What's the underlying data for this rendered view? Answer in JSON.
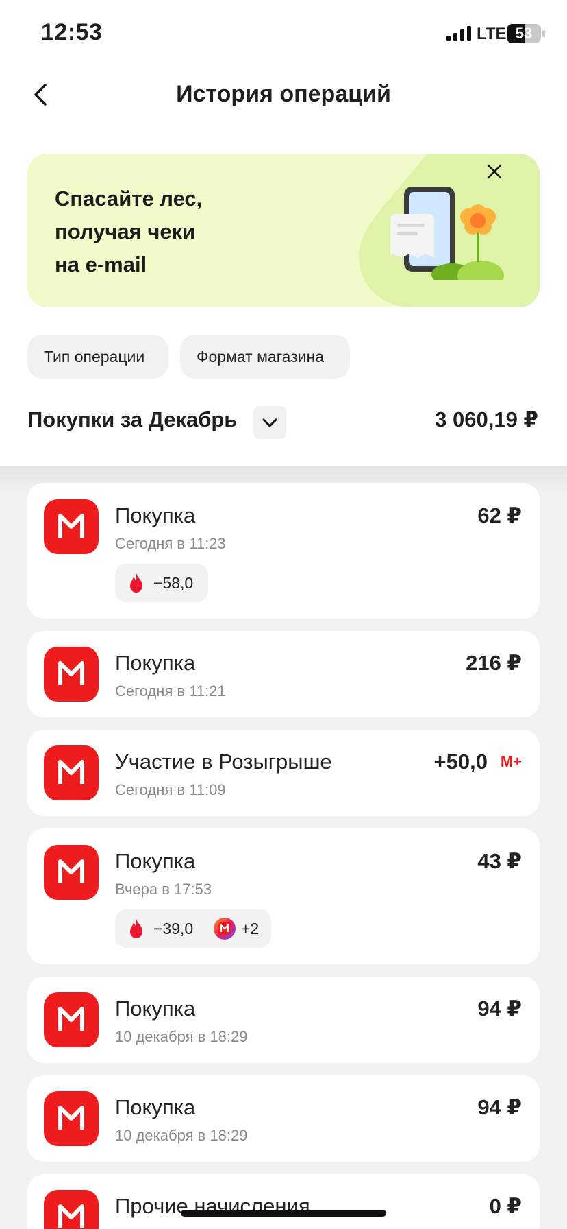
{
  "status_bar": {
    "time": "12:53",
    "network": "LTE",
    "battery": "53",
    "battery_fraction": 0.53
  },
  "header": {
    "title": "История операций"
  },
  "banner": {
    "text_line1": "Спасайте лес,",
    "text_line2": "получая чеки",
    "text_line3": "на e-mail"
  },
  "filters": {
    "type_label": "Тип операции",
    "format_label": "Формат магазина"
  },
  "summary": {
    "label": "Покупки за Декабрь",
    "total": "3 060,19 ₽"
  },
  "operations": [
    {
      "title": "Покупка",
      "date": "Сегодня в 11:23",
      "amount": "62 ₽",
      "points": "−58,0"
    },
    {
      "title": "Покупка",
      "date": "Сегодня в 11:21",
      "amount": "216 ₽"
    },
    {
      "title": "Участие в Розыгрыше",
      "date": "Сегодня в 11:09",
      "amount": "+50,0",
      "badge": "М+"
    },
    {
      "title": "Покупка",
      "date": "Вчера в 17:53",
      "amount": "43 ₽",
      "points": "−39,0",
      "coupons": "+2"
    },
    {
      "title": "Покупка",
      "date": "10 декабря в 18:29",
      "amount": "94 ₽"
    },
    {
      "title": "Покупка",
      "date": "10 декабря в 18:29",
      "amount": "94 ₽"
    },
    {
      "title": "Прочие начисления",
      "date": "",
      "amount": "0 ₽"
    }
  ],
  "colors": {
    "brand_red": "#ee1c1c",
    "banner_bg": "#f1fbc9",
    "banner_accent": "#dff3a8"
  },
  "icons": {
    "back": "chevron-left-icon",
    "close": "close-icon",
    "dropdown": "chevron-down-icon",
    "points": "flame-icon",
    "store": "magnit-logo-icon"
  }
}
